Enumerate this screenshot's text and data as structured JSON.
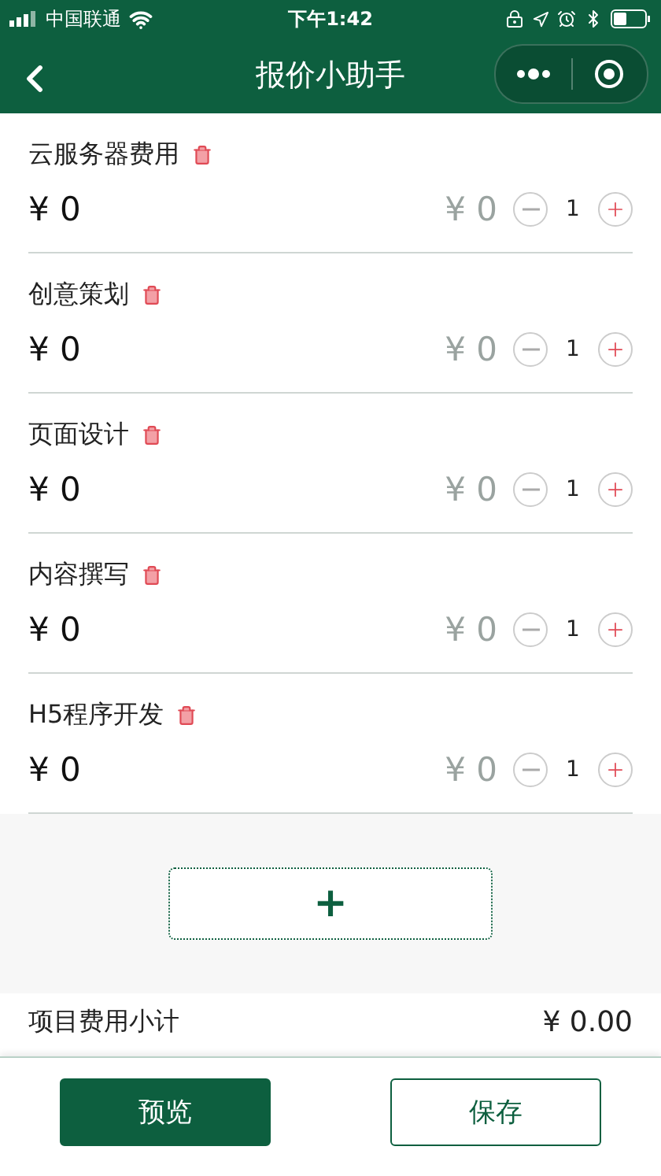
{
  "status_bar": {
    "carrier": "中国联通",
    "time": "下午1:42"
  },
  "nav": {
    "title": "报价小助手"
  },
  "items": [
    {
      "name": "云服务器费用",
      "price": "¥ 0",
      "unit_price": "¥ 0",
      "quantity": "1"
    },
    {
      "name": "创意策划",
      "price": "¥ 0",
      "unit_price": "¥ 0",
      "quantity": "1"
    },
    {
      "name": "页面设计",
      "price": "¥ 0",
      "unit_price": "¥ 0",
      "quantity": "1"
    },
    {
      "name": "内容撰写",
      "price": "¥ 0",
      "unit_price": "¥ 0",
      "quantity": "1"
    },
    {
      "name": "H5程序开发",
      "price": "¥ 0",
      "unit_price": "¥ 0",
      "quantity": "1"
    }
  ],
  "add_button": {
    "label": "+"
  },
  "subtotal": {
    "label": "项目费用小计",
    "value": "¥ 0.00"
  },
  "buttons": [
    {
      "label": "预览",
      "kind": "primary"
    },
    {
      "label": "保存",
      "kind": "outline"
    }
  ]
}
